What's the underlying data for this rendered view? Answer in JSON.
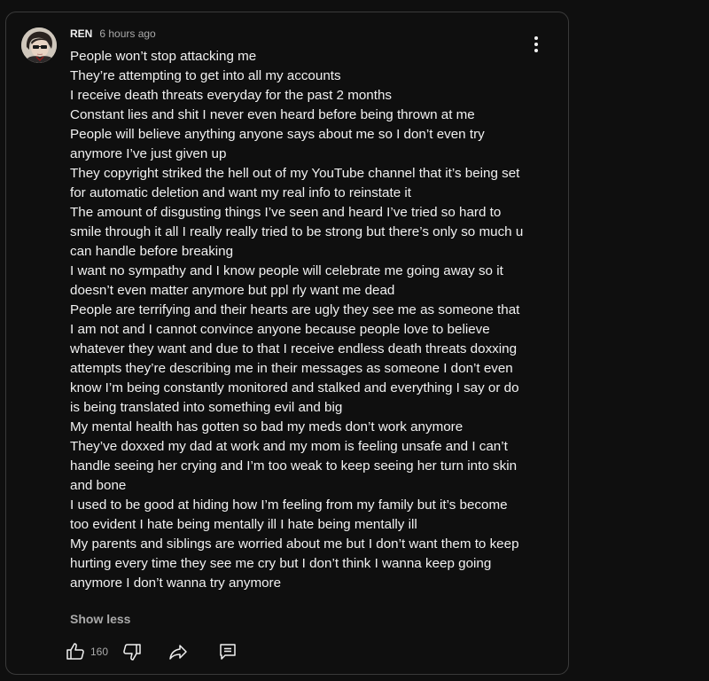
{
  "comment": {
    "author": "REN",
    "time": "6 hours ago",
    "lines": [
      "People won’t stop attacking me",
      "They’re attempting to get into all my accounts",
      "I receive death threats everyday for the past 2 months",
      "Constant lies and shit I never even heard before being thrown at me",
      "People will believe anything anyone says about me so I don’t even try anymore I’ve just given up",
      "They copyright striked the hell out of my YouTube channel that it’s being set for automatic deletion and want my real info to reinstate it",
      "The amount of disgusting things I’ve seen and heard I’ve tried so hard to smile through it all I really really tried to be strong but there’s only so much u can handle before breaking",
      "I want no sympathy and I know people will celebrate me going away so it doesn’t even matter anymore but ppl rly want me dead",
      "People are terrifying and their hearts are ugly they see me as someone that I am not and I cannot convince anyone because people love to believe whatever they want and due to that I receive endless death threats doxxing attempts they’re describing me in their messages as someone I don’t even know I’m being constantly monitored and stalked and everything I say or do is being translated into something evil and big",
      "My mental health has gotten so bad my meds don’t work anymore",
      "They’ve doxxed my dad at work and my mom is feeling unsafe and I can’t handle seeing her crying and I’m too weak to keep seeing her turn into skin and bone",
      "I used to be good at hiding how I’m feeling from my family but it’s become too evident I hate being mentally ill I hate being mentally ill",
      "My parents and siblings are worried about me but I don’t want them to keep hurting every time they see me cry but I don’t think I wanna keep going anymore I don’t wanna try anymore"
    ],
    "show_less_label": "Show less",
    "like_count": "160"
  },
  "icons": {
    "menu": "more-vert-icon",
    "like": "thumb-up-icon",
    "dislike": "thumb-down-icon",
    "share": "share-icon",
    "reply": "reply-comment-icon"
  },
  "colors": {
    "background": "#0f0f0f",
    "border": "#3a3a3a",
    "text": "#f1f1f1",
    "secondary_text": "#aaaaaa"
  }
}
